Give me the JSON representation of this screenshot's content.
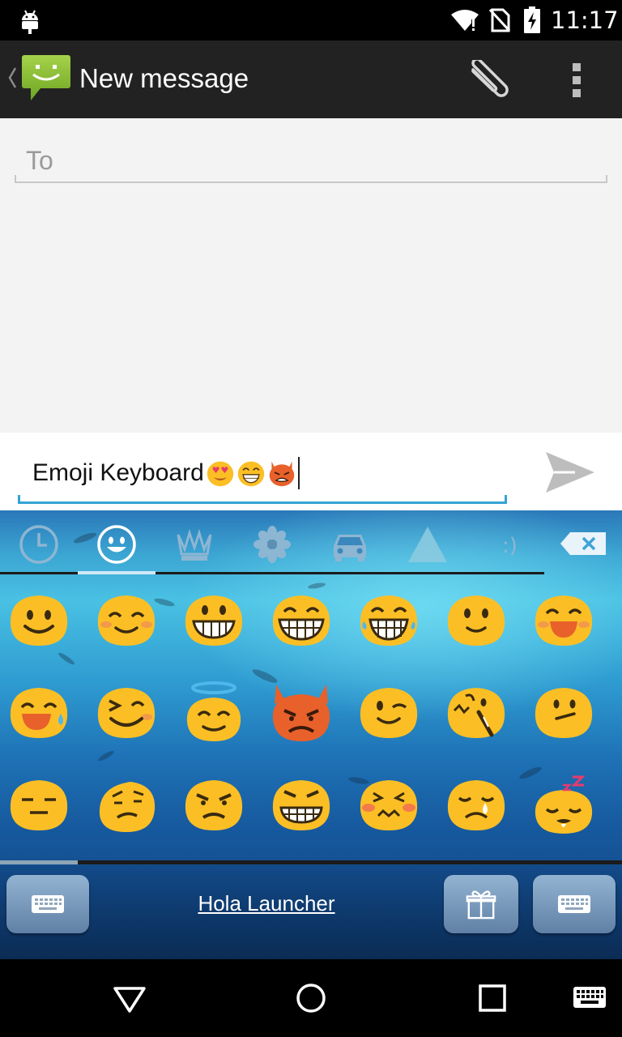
{
  "status_bar": {
    "time": "11:17",
    "icons": [
      "android-icon",
      "wifi-icon",
      "no-sim-icon",
      "battery-charging-icon"
    ]
  },
  "action_bar": {
    "title": "New message",
    "icons": [
      "back-chevron-icon",
      "messaging-app-icon",
      "attach-icon",
      "overflow-menu-icon"
    ]
  },
  "compose": {
    "to_placeholder": "To"
  },
  "message": {
    "text": "Emoji Keyboard",
    "inline_emojis": [
      "heart-eyes-emoji",
      "laughing-emoji",
      "devil-emoji"
    ],
    "send_icon": "send-icon"
  },
  "keyboard": {
    "category_tabs": [
      "recent-icon",
      "smiley-icon",
      "crown-icon",
      "flower-icon",
      "car-icon",
      "triangle-icon",
      "emoticon-icon"
    ],
    "active_category": "smiley-icon",
    "delete_icon": "backspace-icon",
    "emoji_rows": [
      [
        "smile",
        "blush",
        "grin",
        "grin-wide",
        "joy",
        "slight-smile",
        "laughing-blush"
      ],
      [
        "sweat-smile",
        "wink-laugh",
        "angel",
        "devil",
        "wink",
        "scared-bite",
        "slight-frown-neutral"
      ],
      [
        "expressionless",
        "confused",
        "angry",
        "grimace-angry",
        "persevere",
        "sad-tear",
        "sleepy"
      ]
    ],
    "page": 1,
    "bottom": {
      "launcher_link": "Hola Launcher",
      "left_key_icon": "keyboard-icon",
      "gift_icon": "gift-icon",
      "right_key_icon": "keyboard-icon"
    }
  },
  "nav_bar": {
    "buttons": [
      "back-icon",
      "home-icon",
      "recents-icon",
      "keyboard-switch-icon"
    ]
  },
  "colors": {
    "accent": "#33a4d4",
    "emoji_yellow": "#fbbf25",
    "devil_orange": "#e8612b",
    "action_bar": "#222222"
  }
}
